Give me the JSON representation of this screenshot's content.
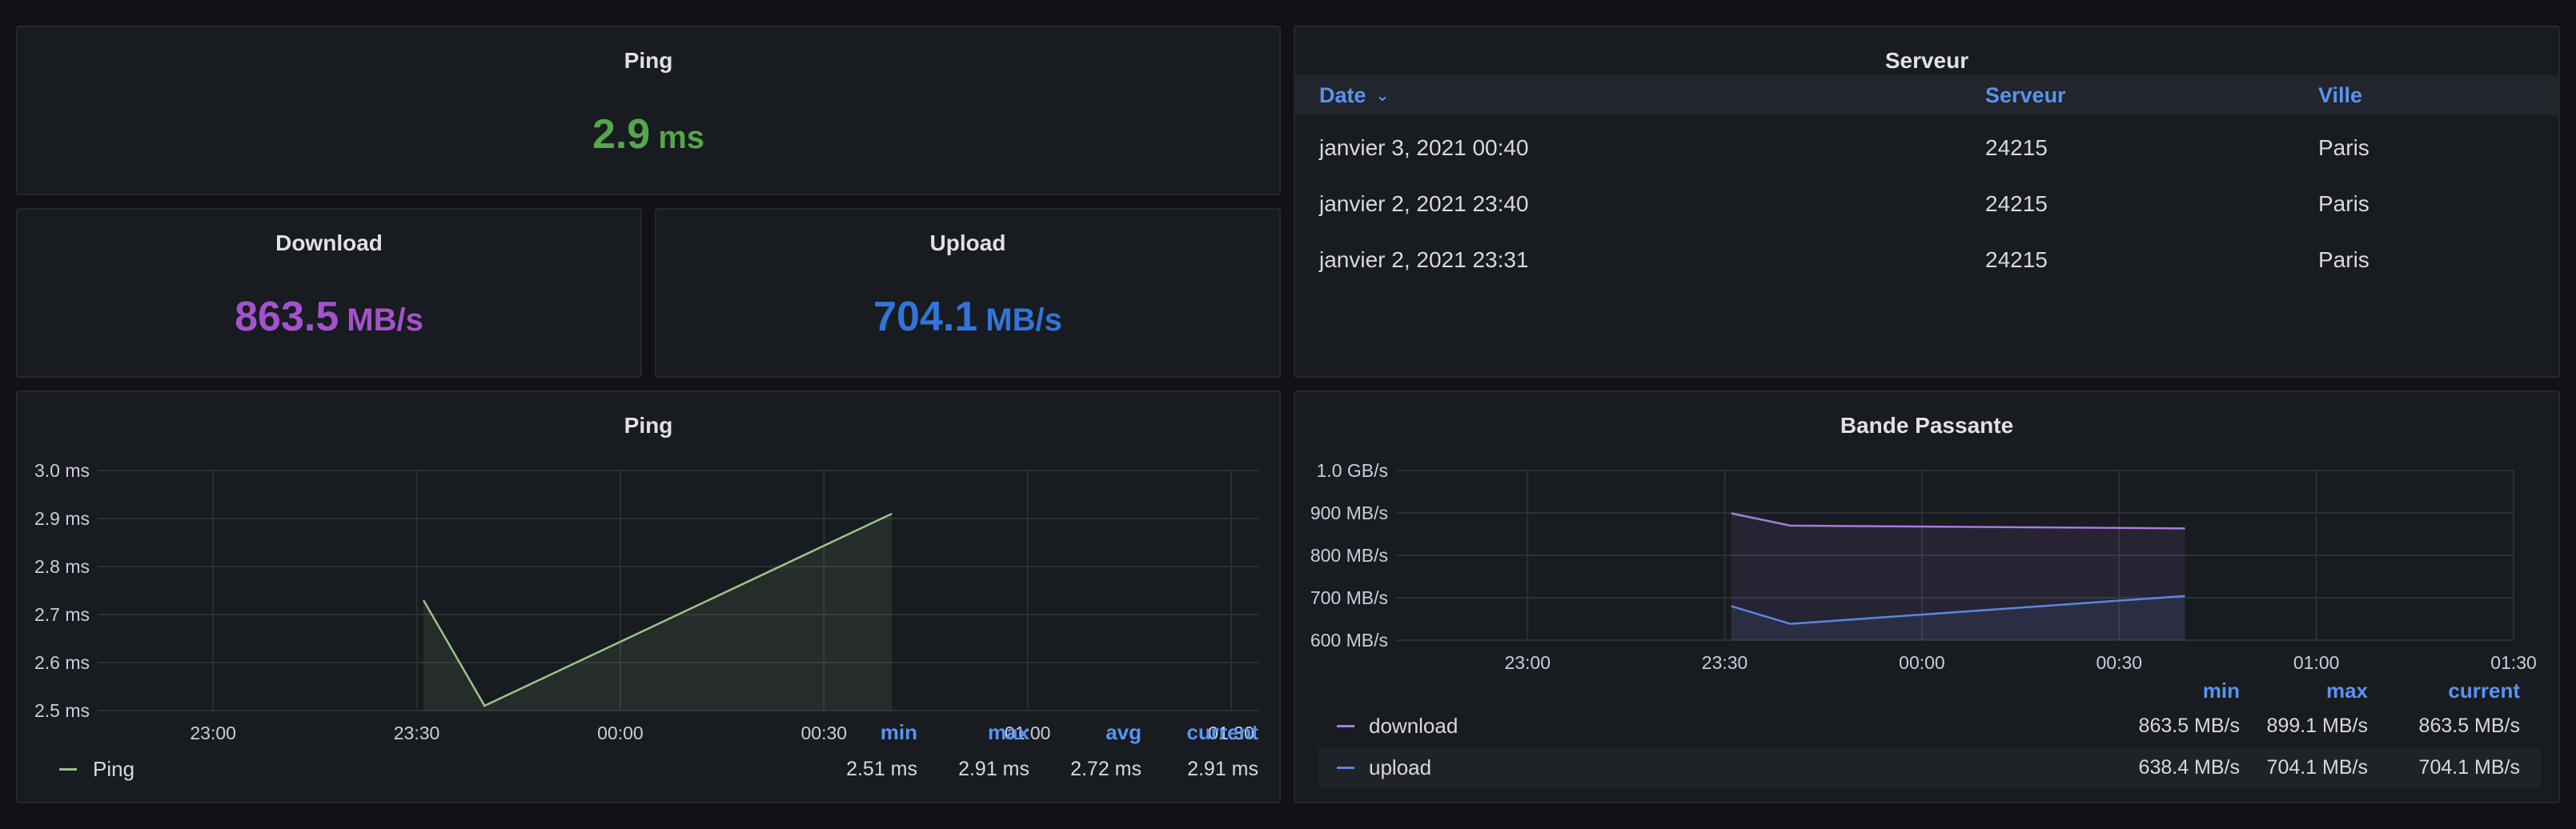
{
  "colors": {
    "ping": "#56a64b",
    "download": "#a352cc",
    "upload": "#3274d9",
    "ping_series": "#9ac48a",
    "download_series": "#a77ae0",
    "upload_series": "#5b86e0",
    "header_blue": "#5794f2"
  },
  "ping_stat": {
    "title": "Ping",
    "value": "2.9",
    "unit": "ms"
  },
  "download_stat": {
    "title": "Download",
    "value": "863.5",
    "unit": "MB/s"
  },
  "upload_stat": {
    "title": "Upload",
    "value": "704.1",
    "unit": "MB/s"
  },
  "server_table": {
    "title": "Serveur",
    "columns": [
      "Date",
      "Serveur",
      "Ville"
    ],
    "sort_icon": "chevron-down-icon",
    "rows": [
      [
        "janvier 3, 2021 00:40",
        "24215",
        "Paris"
      ],
      [
        "janvier 2, 2021 23:40",
        "24215",
        "Paris"
      ],
      [
        "janvier 2, 2021 23:31",
        "24215",
        "Paris"
      ]
    ]
  },
  "ping_graph": {
    "title": "Ping",
    "legend_headers": [
      "min",
      "max",
      "avg",
      "current"
    ],
    "legend": [
      {
        "name": "Ping",
        "min": "2.51 ms",
        "max": "2.91 ms",
        "avg": "2.72 ms",
        "current": "2.91 ms"
      }
    ]
  },
  "bandwidth_graph": {
    "title": "Bande Passante",
    "legend_headers": [
      "min",
      "max",
      "current"
    ],
    "legend": [
      {
        "name": "download",
        "min": "863.5 MB/s",
        "max": "899.1 MB/s",
        "current": "863.5 MB/s"
      },
      {
        "name": "upload",
        "min": "638.4 MB/s",
        "max": "704.1 MB/s",
        "current": "704.1 MB/s"
      }
    ]
  },
  "chart_data": [
    {
      "type": "area",
      "title": "Ping",
      "x_ticks": [
        "23:00",
        "23:30",
        "00:00",
        "00:30",
        "01:00",
        "01:30"
      ],
      "y_ticks": [
        "2.5 ms",
        "2.6 ms",
        "2.7 ms",
        "2.8 ms",
        "2.9 ms",
        "3.0 ms"
      ],
      "xlim": [
        "22:43",
        "01:34"
      ],
      "ylim": [
        2.5,
        3.0
      ],
      "grid": true,
      "series": [
        {
          "name": "Ping",
          "x": [
            "23:31",
            "23:40",
            "00:40"
          ],
          "y": [
            2.73,
            2.51,
            2.91
          ]
        }
      ]
    },
    {
      "type": "area",
      "title": "Bande Passante",
      "x_ticks": [
        "23:00",
        "23:30",
        "00:00",
        "00:30",
        "01:00",
        "01:30"
      ],
      "y_ticks": [
        "600 MB/s",
        "700 MB/s",
        "800 MB/s",
        "900 MB/s",
        "1.0 GB/s"
      ],
      "xlim": [
        "22:40",
        "01:30"
      ],
      "ylim": [
        600,
        1000
      ],
      "grid": true,
      "series": [
        {
          "name": "download",
          "x": [
            "23:31",
            "23:40",
            "00:40"
          ],
          "y": [
            899.1,
            870,
            863.5
          ]
        },
        {
          "name": "upload",
          "x": [
            "23:31",
            "23:40",
            "00:40"
          ],
          "y": [
            680,
            638.4,
            704.1
          ]
        }
      ]
    }
  ]
}
